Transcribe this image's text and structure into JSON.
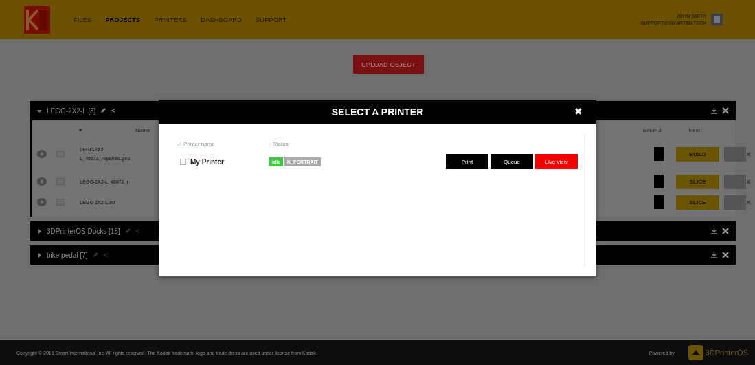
{
  "topbar": {
    "nav": [
      {
        "label": "FILES",
        "selected": false
      },
      {
        "label": "PROJECTS",
        "selected": true
      },
      {
        "label": "PRINTERS",
        "selected": false
      },
      {
        "label": "DASHBOARD",
        "selected": false
      },
      {
        "label": "SUPPORT",
        "selected": false
      }
    ],
    "user_name": "JOHN SMITH",
    "user_email": "SUPPORT@SMART3D.TECH"
  },
  "upload_button": "UPLOAD OBJECT",
  "projects": [
    {
      "title": "LEGO-2X2-L [3]",
      "expanded": true,
      "columns": [
        "Name",
        "STEP 3",
        "Next"
      ],
      "rows": [
        {
          "checked": false,
          "name_lines": [
            "LEGO-2X2",
            "L_48072_repaired.gco"
          ],
          "step": "BUILD"
        },
        {
          "checked": false,
          "name_lines": [
            "LEGO-2X2-L_48072_r"
          ],
          "step": "SLICE"
        },
        {
          "checked": false,
          "name_lines": [
            "LEGO-2X2-L.stl"
          ],
          "step": "SLICE"
        }
      ]
    },
    {
      "title": "3DPrinterOS Ducks [18]",
      "expanded": false
    },
    {
      "title": "bike pedal [7]",
      "expanded": false
    }
  ],
  "modal": {
    "title": "SELECT A PRINTER",
    "close": "✖",
    "columns": [
      "Printer name",
      "Status"
    ],
    "printers": [
      {
        "name": "My Printer",
        "checked": false,
        "status": "idle",
        "tag": "K_PORTRAIT",
        "buttons": [
          {
            "label": "Print",
            "kind": "dark"
          },
          {
            "label": "Queue",
            "kind": "dark"
          },
          {
            "label": "Live view",
            "kind": "accent"
          }
        ]
      }
    ]
  },
  "footer": {
    "copyright": "Copyright © 2016 Smart International Inc. All rights reserved. The Kodak trademark, logo and trade dress are used under license from Kodak.",
    "powered_by": "Powered by",
    "brand": "3DPrinterOS"
  }
}
